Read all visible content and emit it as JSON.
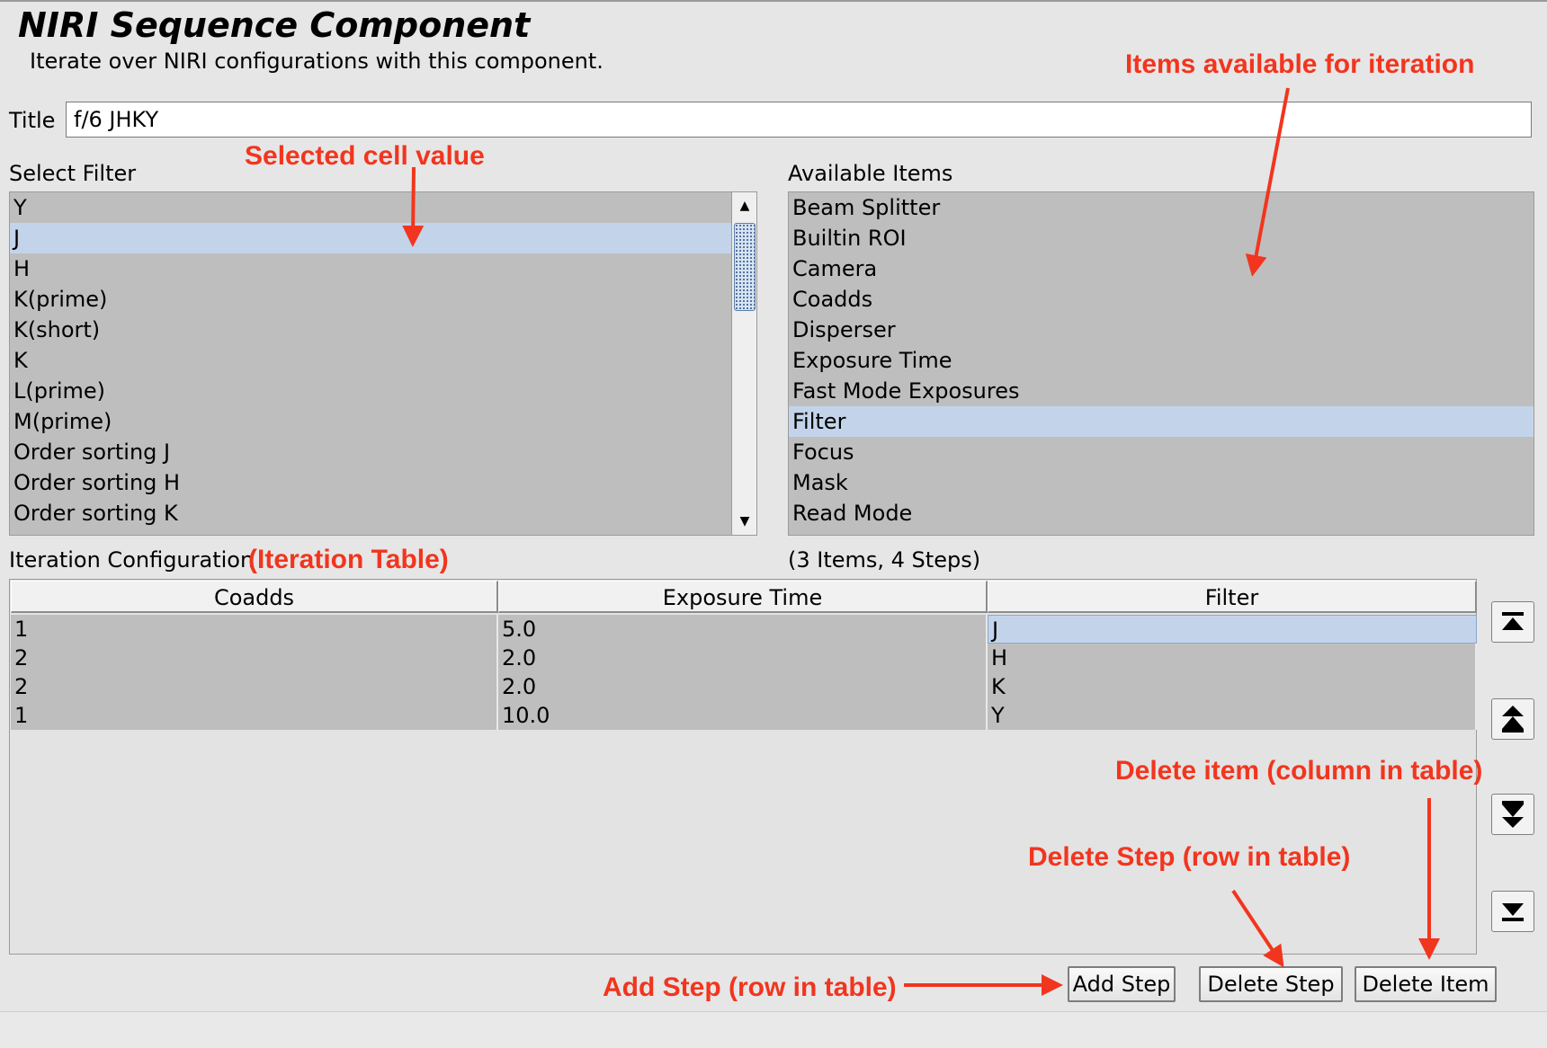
{
  "header": {
    "title": "NIRI Sequence Component",
    "description": "Iterate over NIRI configurations with this component."
  },
  "title_field": {
    "label": "Title",
    "value": "f/6 JHKY"
  },
  "filter_list": {
    "label": "Select Filter",
    "items": [
      "Y",
      "J",
      "H",
      "K(prime)",
      "K(short)",
      "K",
      "L(prime)",
      "M(prime)",
      "Order sorting J",
      "Order sorting H",
      "Order sorting K"
    ],
    "selected": "J"
  },
  "available_items": {
    "label": "Available Items",
    "items": [
      "Beam Splitter",
      "Builtin ROI",
      "Camera",
      "Coadds",
      "Disperser",
      "Exposure Time",
      "Fast Mode Exposures",
      "Filter",
      "Focus",
      "Mask",
      "Read Mode"
    ],
    "selected": "Filter"
  },
  "iteration": {
    "label": "Iteration Configuration",
    "summary": "(3 Items, 4 Steps)",
    "columns": [
      "Coadds",
      "Exposure Time",
      "Filter"
    ],
    "rows": [
      [
        "1",
        "5.0",
        "J"
      ],
      [
        "2",
        "2.0",
        "H"
      ],
      [
        "2",
        "2.0",
        "K"
      ],
      [
        "1",
        "10.0",
        "Y"
      ]
    ]
  },
  "buttons": {
    "add_step": "Add Step",
    "delete_step": "Delete Step",
    "delete_item": "Delete Item"
  },
  "side_buttons": [
    "move-to-top-icon",
    "move-up-icon",
    "move-down-icon",
    "move-to-bottom-icon"
  ],
  "annotations": {
    "items_available": "Items available for iteration",
    "selected_cell": "Selected cell value",
    "iteration_table": "(Iteration Table)",
    "delete_item": "Delete item (column in table)",
    "delete_step": "Delete Step (row in table)",
    "add_step": "Add Step (row in table)"
  },
  "colors": {
    "annotation": "#f2351e",
    "selection": "#c3d4ea",
    "list_background": "#bebebe"
  }
}
